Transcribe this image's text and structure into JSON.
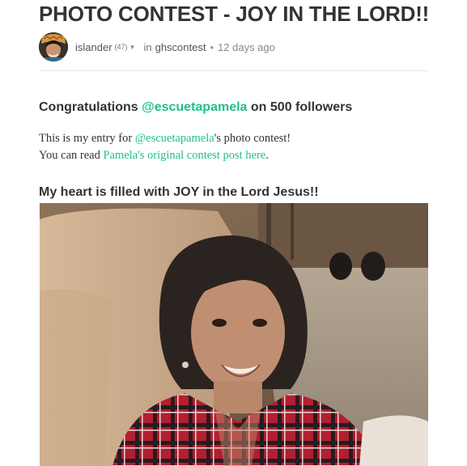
{
  "post": {
    "title": "PHOTO CONTEST - JOY IN THE LORD!!",
    "author": "islander",
    "reputation": "(47)",
    "in_label": "in",
    "community": "ghscontest",
    "separator": "•",
    "posted_ago": "12 days ago"
  },
  "body": {
    "congrats_prefix": "Congratulations ",
    "congrats_mention": "@escuetapamela",
    "congrats_suffix": " on 500 followers",
    "entry_prefix": "This is my entry for ",
    "entry_mention": "@escuetapamela",
    "entry_suffix": "'s photo contest!",
    "read_prefix": "You can read ",
    "read_link": "Pamela's original contest post here",
    "read_suffix": ".",
    "joy_heading": "My heart is filled with JOY in the Lord Jesus!!"
  },
  "colors": {
    "link": "#1fbf8f",
    "text": "#333333",
    "meta": "#888888"
  },
  "icons": {
    "caret": "caret-down-icon",
    "avatar": "user-avatar"
  }
}
